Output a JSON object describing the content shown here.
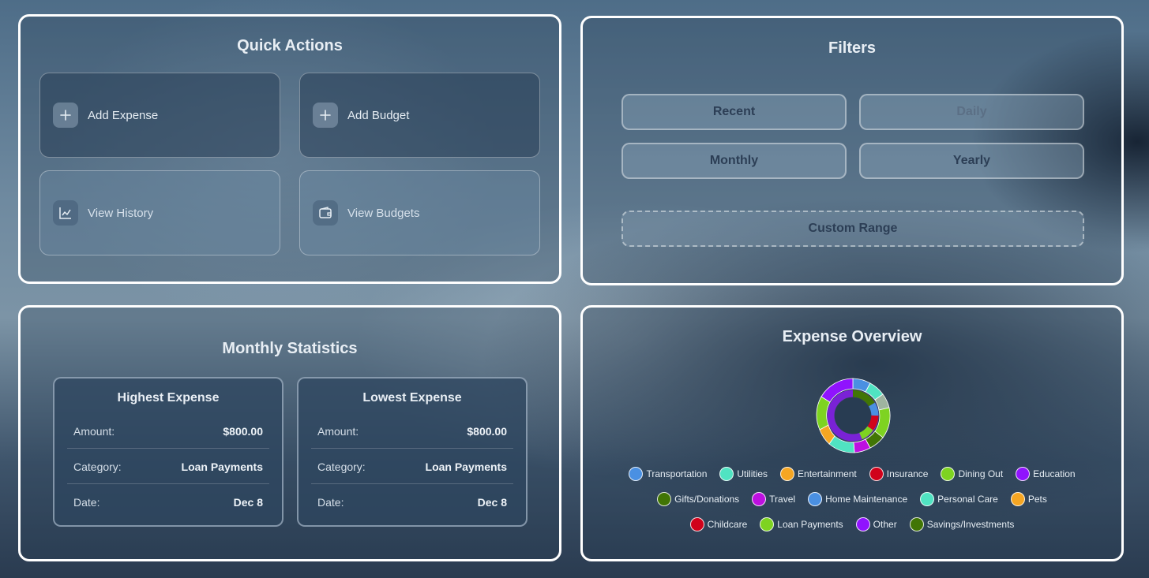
{
  "quick_actions": {
    "title": "Quick Actions",
    "add_expense": "Add Expense",
    "add_budget": "Add Budget",
    "view_history": "View History",
    "view_budgets": "View Budgets"
  },
  "filters": {
    "title": "Filters",
    "recent": "Recent",
    "daily": "Daily",
    "monthly": "Monthly",
    "yearly": "Yearly",
    "custom_range": "Custom Range"
  },
  "stats": {
    "title": "Monthly Statistics",
    "highest": {
      "title": "Highest Expense",
      "amount_label": "Amount:",
      "amount": "$800.00",
      "category_label": "Category:",
      "category": "Loan Payments",
      "date_label": "Date:",
      "date": "Dec 8"
    },
    "lowest": {
      "title": "Lowest Expense",
      "amount_label": "Amount:",
      "amount": "$800.00",
      "category_label": "Category:",
      "category": "Loan Payments",
      "date_label": "Date:",
      "date": "Dec 8"
    }
  },
  "overview": {
    "title": "Expense Overview",
    "legend": [
      {
        "label": "Transportation",
        "color": "#4a90e2"
      },
      {
        "label": "Utilities",
        "color": "#50e3c2"
      },
      {
        "label": "Entertainment",
        "color": "#f5a623"
      },
      {
        "label": "Insurance",
        "color": "#d0021b"
      },
      {
        "label": "Dining Out",
        "color": "#7ed321"
      },
      {
        "label": "Education",
        "color": "#9013fe"
      },
      {
        "label": "Gifts/Donations",
        "color": "#417505"
      },
      {
        "label": "Travel",
        "color": "#bd10e0"
      },
      {
        "label": "Home Maintenance",
        "color": "#4a90e2"
      },
      {
        "label": "Personal Care",
        "color": "#50e3c2"
      },
      {
        "label": "Pets",
        "color": "#f5a623"
      },
      {
        "label": "Childcare",
        "color": "#d0021b"
      },
      {
        "label": "Loan Payments",
        "color": "#7ed321"
      },
      {
        "label": "Other",
        "color": "#9013fe"
      },
      {
        "label": "Savings/Investments",
        "color": "#417505"
      }
    ]
  }
}
